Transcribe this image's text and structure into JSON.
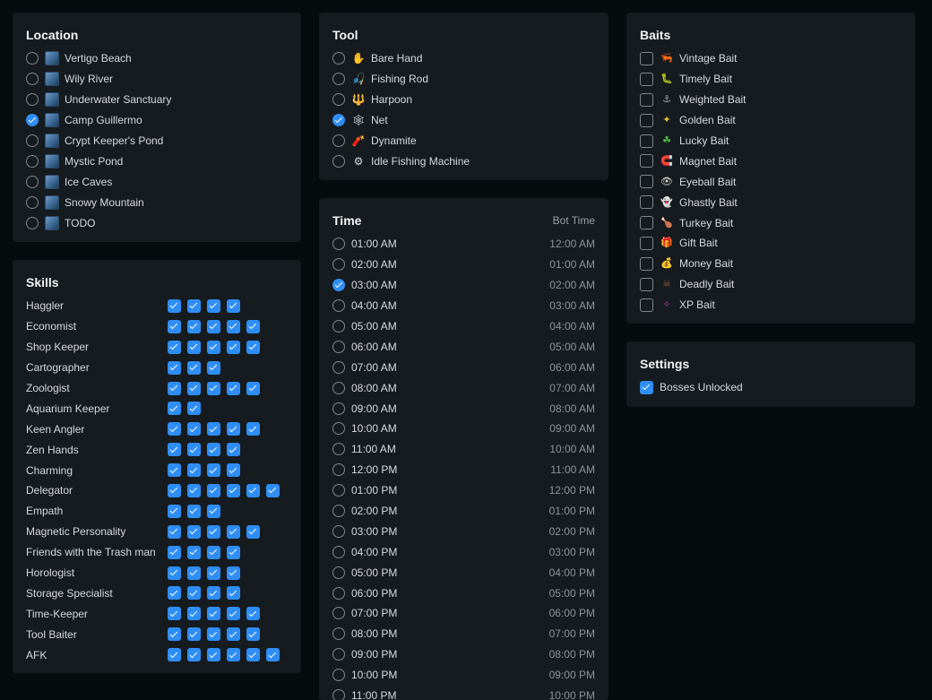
{
  "location": {
    "title": "Location",
    "items": [
      {
        "label": "Vertigo Beach",
        "selected": false
      },
      {
        "label": "Wily River",
        "selected": false
      },
      {
        "label": "Underwater Sanctuary",
        "selected": false
      },
      {
        "label": "Camp Guillermo",
        "selected": true
      },
      {
        "label": "Crypt Keeper's Pond",
        "selected": false
      },
      {
        "label": "Mystic Pond",
        "selected": false
      },
      {
        "label": "Ice Caves",
        "selected": false
      },
      {
        "label": "Snowy Mountain",
        "selected": false
      },
      {
        "label": "TODO",
        "selected": false
      }
    ]
  },
  "tool": {
    "title": "Tool",
    "items": [
      {
        "label": "Bare Hand",
        "selected": false,
        "icon": "hand-icon"
      },
      {
        "label": "Fishing Rod",
        "selected": false,
        "icon": "fishing-rod-icon"
      },
      {
        "label": "Harpoon",
        "selected": false,
        "icon": "harpoon-icon"
      },
      {
        "label": "Net",
        "selected": true,
        "icon": "net-icon"
      },
      {
        "label": "Dynamite",
        "selected": false,
        "icon": "dynamite-icon"
      },
      {
        "label": "Idle Fishing Machine",
        "selected": false,
        "icon": "machine-icon"
      }
    ]
  },
  "baits": {
    "title": "Baits",
    "items": [
      {
        "label": "Vintage Bait",
        "checked": false,
        "icon": "vintage-bait-icon",
        "color": "#b04fd0"
      },
      {
        "label": "Timely Bait",
        "checked": false,
        "icon": "timely-bait-icon",
        "color": "#c9a25a"
      },
      {
        "label": "Weighted Bait",
        "checked": false,
        "icon": "weighted-bait-icon",
        "color": "#9aa6b4"
      },
      {
        "label": "Golden Bait",
        "checked": false,
        "icon": "golden-bait-icon",
        "color": "#e8c13a"
      },
      {
        "label": "Lucky Bait",
        "checked": false,
        "icon": "lucky-bait-icon",
        "color": "#4fbf4a"
      },
      {
        "label": "Magnet Bait",
        "checked": false,
        "icon": "magnet-bait-icon",
        "color": "#d2413a"
      },
      {
        "label": "Eyeball Bait",
        "checked": false,
        "icon": "eyeball-bait-icon",
        "color": "#e0d8d0"
      },
      {
        "label": "Ghastly Bait",
        "checked": false,
        "icon": "ghastly-bait-icon",
        "color": "#cfd6de"
      },
      {
        "label": "Turkey Bait",
        "checked": false,
        "icon": "turkey-bait-icon",
        "color": "#c0702e"
      },
      {
        "label": "Gift Bait",
        "checked": false,
        "icon": "gift-bait-icon",
        "color": "#7aa24a"
      },
      {
        "label": "Money Bait",
        "checked": false,
        "icon": "money-bait-icon",
        "color": "#9bbb5a"
      },
      {
        "label": "Deadly Bait",
        "checked": false,
        "icon": "deadly-bait-icon",
        "color": "#8c5a3a"
      },
      {
        "label": "XP Bait",
        "checked": false,
        "icon": "xp-bait-icon",
        "color": "#c23fb8"
      }
    ]
  },
  "skills": {
    "title": "Skills",
    "items": [
      {
        "label": "Haggler",
        "boxes": 4
      },
      {
        "label": "Economist",
        "boxes": 5
      },
      {
        "label": "Shop Keeper",
        "boxes": 5
      },
      {
        "label": "Cartographer",
        "boxes": 3
      },
      {
        "label": "Zoologist",
        "boxes": 5
      },
      {
        "label": "Aquarium Keeper",
        "boxes": 2
      },
      {
        "label": "Keen Angler",
        "boxes": 5
      },
      {
        "label": "Zen Hands",
        "boxes": 4
      },
      {
        "label": "Charming",
        "boxes": 4
      },
      {
        "label": "Delegator",
        "boxes": 6
      },
      {
        "label": "Empath",
        "boxes": 3
      },
      {
        "label": "Magnetic Personality",
        "boxes": 5
      },
      {
        "label": "Friends with the Trash man",
        "boxes": 4
      },
      {
        "label": "Horologist",
        "boxes": 4
      },
      {
        "label": "Storage Specialist",
        "boxes": 4
      },
      {
        "label": "Time-Keeper",
        "boxes": 5
      },
      {
        "label": "Tool Baiter",
        "boxes": 5
      },
      {
        "label": "AFK",
        "boxes": 6
      }
    ]
  },
  "time": {
    "title": "Time",
    "bot_time_label": "Bot Time",
    "items": [
      {
        "time": "01:00 AM",
        "bot": "12:00 AM",
        "selected": false
      },
      {
        "time": "02:00 AM",
        "bot": "01:00 AM",
        "selected": false
      },
      {
        "time": "03:00 AM",
        "bot": "02:00 AM",
        "selected": true
      },
      {
        "time": "04:00 AM",
        "bot": "03:00 AM",
        "selected": false
      },
      {
        "time": "05:00 AM",
        "bot": "04:00 AM",
        "selected": false
      },
      {
        "time": "06:00 AM",
        "bot": "05:00 AM",
        "selected": false
      },
      {
        "time": "07:00 AM",
        "bot": "06:00 AM",
        "selected": false
      },
      {
        "time": "08:00 AM",
        "bot": "07:00 AM",
        "selected": false
      },
      {
        "time": "09:00 AM",
        "bot": "08:00 AM",
        "selected": false
      },
      {
        "time": "10:00 AM",
        "bot": "09:00 AM",
        "selected": false
      },
      {
        "time": "11:00 AM",
        "bot": "10:00 AM",
        "selected": false
      },
      {
        "time": "12:00 PM",
        "bot": "11:00 AM",
        "selected": false
      },
      {
        "time": "01:00 PM",
        "bot": "12:00 PM",
        "selected": false
      },
      {
        "time": "02:00 PM",
        "bot": "01:00 PM",
        "selected": false
      },
      {
        "time": "03:00 PM",
        "bot": "02:00 PM",
        "selected": false
      },
      {
        "time": "04:00 PM",
        "bot": "03:00 PM",
        "selected": false
      },
      {
        "time": "05:00 PM",
        "bot": "04:00 PM",
        "selected": false
      },
      {
        "time": "06:00 PM",
        "bot": "05:00 PM",
        "selected": false
      },
      {
        "time": "07:00 PM",
        "bot": "06:00 PM",
        "selected": false
      },
      {
        "time": "08:00 PM",
        "bot": "07:00 PM",
        "selected": false
      },
      {
        "time": "09:00 PM",
        "bot": "08:00 PM",
        "selected": false
      },
      {
        "time": "10:00 PM",
        "bot": "09:00 PM",
        "selected": false
      },
      {
        "time": "11:00 PM",
        "bot": "10:00 PM",
        "selected": false
      }
    ]
  },
  "settings": {
    "title": "Settings",
    "items": [
      {
        "label": "Bosses Unlocked",
        "checked": true
      }
    ]
  }
}
